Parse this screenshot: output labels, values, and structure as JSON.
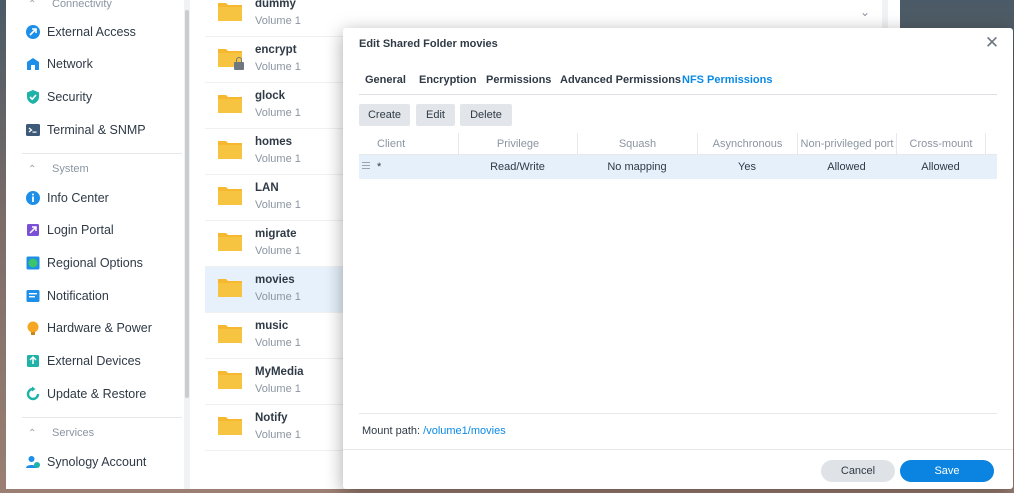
{
  "sidebar": {
    "sections": [
      {
        "label": "Connectivity"
      },
      {
        "label": "System"
      },
      {
        "label": "Services"
      }
    ],
    "items": [
      {
        "label": "External Access",
        "icon": "external-access-icon"
      },
      {
        "label": "Network",
        "icon": "network-icon"
      },
      {
        "label": "Security",
        "icon": "security-shield-icon"
      },
      {
        "label": "Terminal & SNMP",
        "icon": "terminal-icon"
      },
      {
        "label": "Info Center",
        "icon": "info-icon"
      },
      {
        "label": "Login Portal",
        "icon": "login-portal-icon"
      },
      {
        "label": "Regional Options",
        "icon": "regional-options-icon"
      },
      {
        "label": "Notification",
        "icon": "notification-icon"
      },
      {
        "label": "Hardware & Power",
        "icon": "hardware-power-icon"
      },
      {
        "label": "External Devices",
        "icon": "external-devices-icon"
      },
      {
        "label": "Update & Restore",
        "icon": "update-restore-icon"
      },
      {
        "label": "Synology Account",
        "icon": "synology-account-icon"
      }
    ]
  },
  "folders": [
    {
      "name": "dummy",
      "volume": "Volume 1"
    },
    {
      "name": "encrypt",
      "volume": "Volume 1"
    },
    {
      "name": "glock",
      "volume": "Volume 1"
    },
    {
      "name": "homes",
      "volume": "Volume 1"
    },
    {
      "name": "LAN",
      "volume": "Volume 1"
    },
    {
      "name": "migrate",
      "volume": "Volume 1"
    },
    {
      "name": "movies",
      "volume": "Volume 1"
    },
    {
      "name": "music",
      "volume": "Volume 1"
    },
    {
      "name": "MyMedia",
      "volume": "Volume 1"
    },
    {
      "name": "Notify",
      "volume": "Volume 1"
    }
  ],
  "dialog": {
    "title": "Edit Shared Folder movies",
    "tabs": [
      "General",
      "Encryption",
      "Permissions",
      "Advanced Permissions",
      "NFS Permissions"
    ],
    "active_tab": "NFS Permissions",
    "toolbar": {
      "create": "Create",
      "edit": "Edit",
      "delete": "Delete"
    },
    "columns": [
      "Client",
      "Privilege",
      "Squash",
      "Asynchronous",
      "Non-privileged port",
      "Cross-mount"
    ],
    "rows": [
      [
        "*",
        "Read/Write",
        "No mapping",
        "Yes",
        "Allowed",
        "Allowed"
      ]
    ],
    "mount_label": "Mount path:",
    "mount_path": "/volume1/movies",
    "cancel": "Cancel",
    "save": "Save"
  },
  "colors": {
    "accent": "#0a84e0",
    "selected_row": "#e5f0fb",
    "folder": "#f5b82e"
  }
}
